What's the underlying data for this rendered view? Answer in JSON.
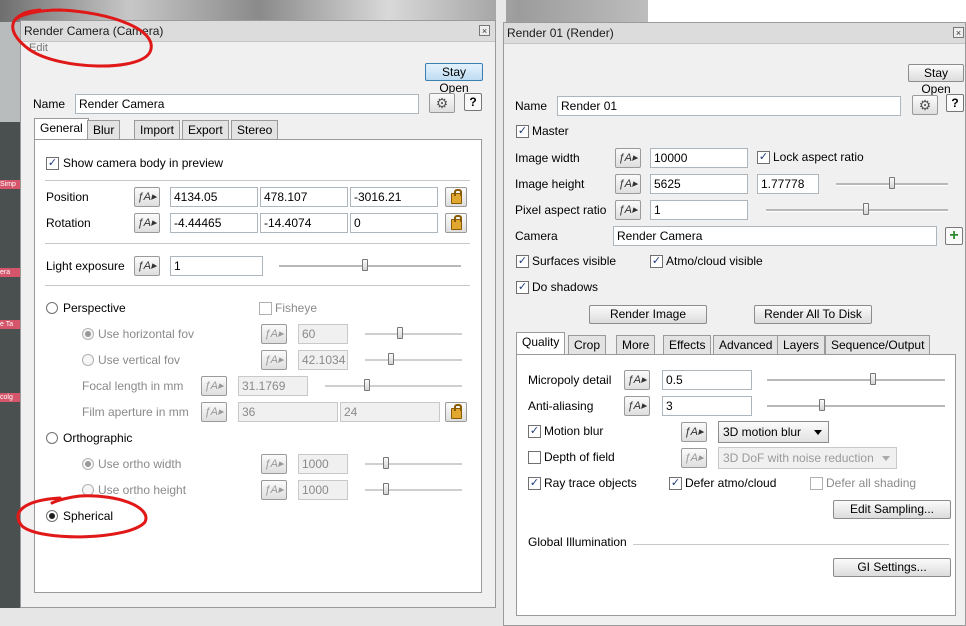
{
  "camera_window": {
    "title": "Render Camera    (Camera)",
    "menu_edit": "Edit",
    "stay_open": "Stay Open",
    "name_label": "Name",
    "name_value": "Render Camera",
    "help_label": "?",
    "tabs": [
      "General",
      "Blur",
      "Import",
      "Export",
      "Stereo"
    ],
    "show_body_label": "Show camera body in preview",
    "position_label": "Position",
    "position": [
      "4134.05",
      "478.107",
      "-3016.21"
    ],
    "rotation_label": "Rotation",
    "rotation": [
      "-4.44465",
      "-14.4074",
      "0"
    ],
    "light_exposure_label": "Light exposure",
    "light_exposure_value": "1",
    "perspective_label": "Perspective",
    "fisheye_label": "Fisheye",
    "use_hfov_label": "Use horizontal fov",
    "hfov_value": "60",
    "use_vfov_label": "Use vertical fov",
    "vfov_value": "42.1034",
    "focal_label": "Focal length in mm",
    "focal_value": "31.1769",
    "film_label": "Film aperture in mm",
    "film_values": [
      "36",
      "24"
    ],
    "orthographic_label": "Orthographic",
    "ortho_width_label": "Use ortho width",
    "ortho_width_value": "1000",
    "ortho_height_label": "Use ortho height",
    "ortho_height_value": "1000",
    "spherical_label": "Spherical",
    "slider_levels": {
      "light_exposure": 0.47,
      "hfov": 0.35,
      "vfov": 0.25,
      "focal": 0.3,
      "ortho_width": 0.2,
      "ortho_height": 0.2
    }
  },
  "render_window": {
    "title": "Render 01    (Render)",
    "stay_open": "Stay Open",
    "name_label": "Name",
    "name_value": "Render 01",
    "help_label": "?",
    "master_label": "Master",
    "image_width_label": "Image width",
    "image_width_value": "10000",
    "lock_aspect_label": "Lock aspect ratio",
    "image_height_label": "Image height",
    "image_height_value": "5625",
    "aspect_value": "1.77778",
    "pixel_aspect_label": "Pixel aspect ratio",
    "pixel_aspect_value": "1",
    "camera_label": "Camera",
    "camera_value": "Render Camera",
    "surfaces_visible_label": "Surfaces visible",
    "atmo_visible_label": "Atmo/cloud visible",
    "do_shadows_label": "Do shadows",
    "render_image_label": "Render Image",
    "render_all_label": "Render All To Disk",
    "tabs": [
      "Quality",
      "Crop",
      "More",
      "Effects",
      "Advanced",
      "Layers",
      "Sequence/Output"
    ],
    "micropoly_label": "Micropoly detail",
    "micropoly_value": "0.5",
    "antialias_label": "Anti-aliasing",
    "antialias_value": "3",
    "motion_blur_label": "Motion blur",
    "motion_blur_select": "3D motion blur",
    "dof_label": "Depth of field",
    "dof_select": "3D DoF with noise reduction",
    "ray_trace_label": "Ray trace objects",
    "defer_atmo_label": "Defer atmo/cloud",
    "defer_shading_label": "Defer all shading",
    "edit_sampling_label": "Edit Sampling...",
    "gi_label": "Global Illumination",
    "gi_settings_label": "GI Settings...",
    "slider_levels": {
      "aspect": 0.5,
      "pixel_aspect": 0.55,
      "micropoly": 0.6,
      "antialias": 0.3
    }
  },
  "backdrop_tags": [
    "Simp",
    "era",
    "e Ta",
    "colg"
  ],
  "accent_colors": {
    "annotation": "#e01818",
    "button_blue": "#bfdcf3",
    "checkbox_mark": "#1c3a7a"
  }
}
